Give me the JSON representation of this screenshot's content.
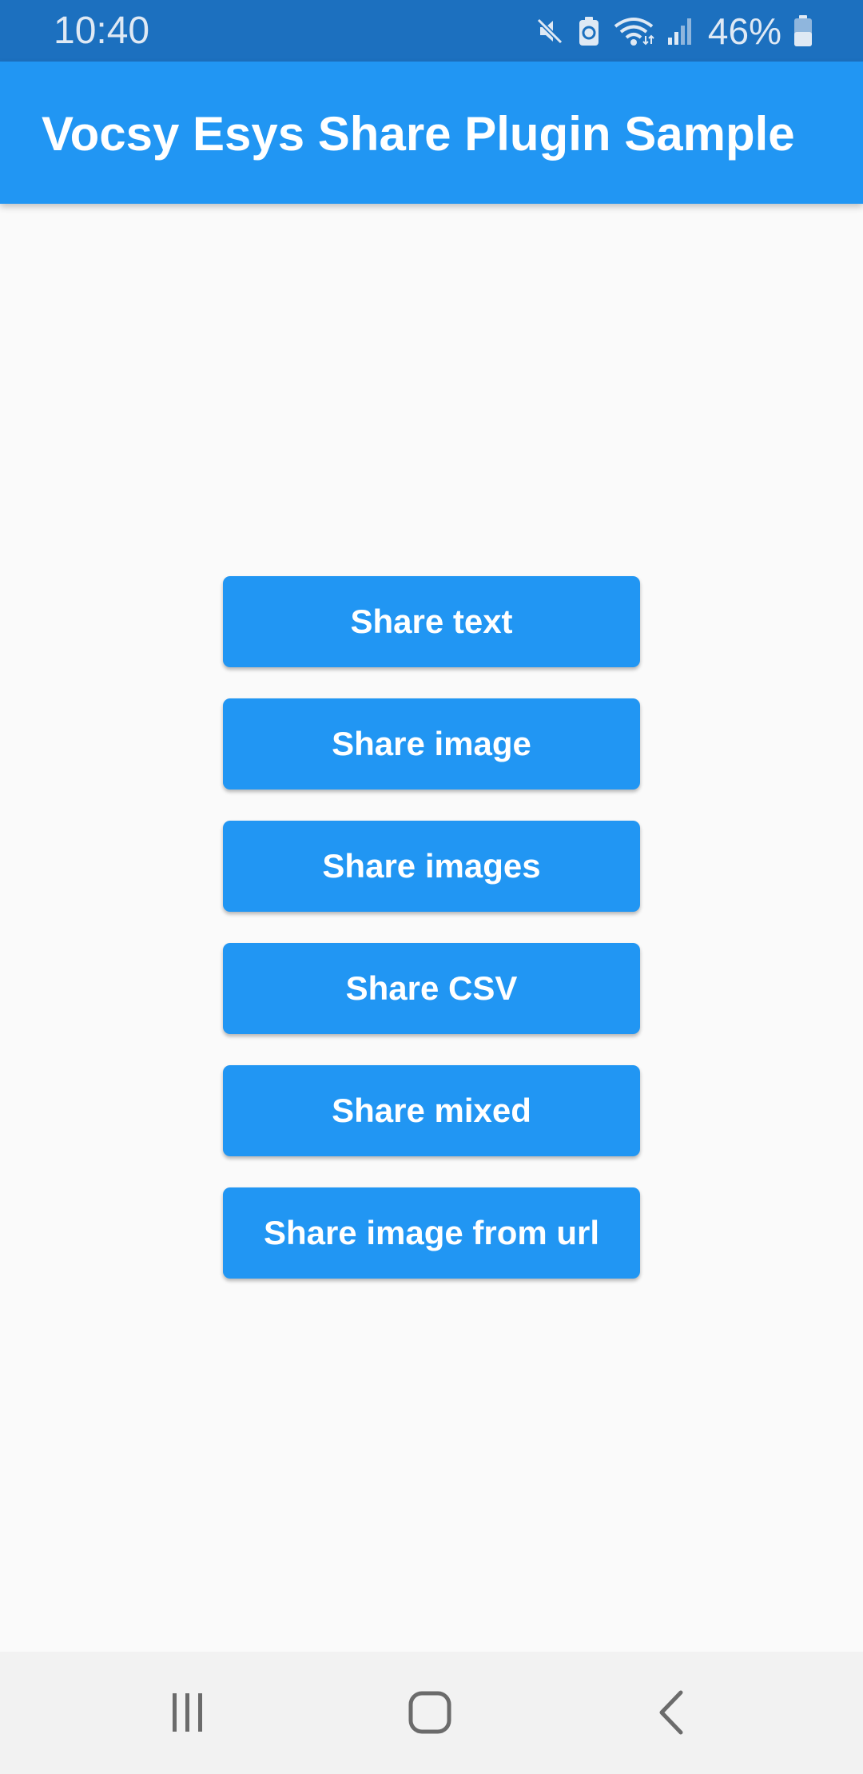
{
  "status_bar": {
    "time": "10:40",
    "battery_percent": "46%",
    "icons": [
      "mute-icon",
      "battery-saver-icon",
      "wifi-icon",
      "signal-icon",
      "battery-icon"
    ]
  },
  "app_bar": {
    "title": "Vocsy Esys Share Plugin Sample"
  },
  "buttons": [
    {
      "label": "Share text"
    },
    {
      "label": "Share image"
    },
    {
      "label": "Share images"
    },
    {
      "label": "Share CSV"
    },
    {
      "label": "Share mixed"
    },
    {
      "label": "Share image from url"
    }
  ],
  "nav_bar": {
    "icons": [
      "recent-apps-icon",
      "home-icon",
      "back-icon"
    ]
  },
  "colors": {
    "status_bar": "#1c70bf",
    "app_bar": "#2196f3",
    "button": "#2196f3",
    "background": "#fafafa",
    "nav_bar": "#f2f2f2"
  }
}
